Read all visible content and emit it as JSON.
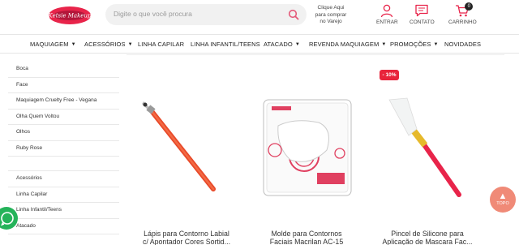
{
  "header": {
    "logo_text": "Ketsie Makeup",
    "search_placeholder": "Digite o que você procura",
    "varejo_line1": "Clique Aqui",
    "varejo_line2": "para comprar",
    "varejo_line3": "no Varejo",
    "entrar_label": "ENTRAR",
    "contato_label": "CONTATO",
    "carrinho_label": "CARRINHO",
    "cart_count": "0"
  },
  "nav": [
    {
      "label": "MAQUIAGEM",
      "chevron": true
    },
    {
      "label": "ACESSÓRIOS",
      "chevron": true
    },
    {
      "label": "LINHA CAPILAR",
      "chevron": false
    },
    {
      "label": "LINHA INFANTIL/TEENS",
      "chevron": false
    },
    {
      "label": "ATACADO",
      "chevron": true
    },
    {
      "label": "REVENDA MAQUIAGEM",
      "chevron": true
    },
    {
      "label": "PROMOÇÕES",
      "chevron": true
    },
    {
      "label": "NOVIDADES",
      "chevron": false
    }
  ],
  "sidebar": {
    "group1": [
      "Boca",
      "Face",
      "Maquiagem Cruelty Free - Vegana",
      "Olha Quem Voltou",
      "Olhos",
      "Ruby Rose"
    ],
    "group2": [
      "Acessórios",
      "Linha Capilar",
      "Linha Infantil/Teens",
      "Atacado"
    ]
  },
  "products": [
    {
      "line1": "Lápis para Contorno Labial",
      "line2": "c/ Apontador Cores Sortid..."
    },
    {
      "line1": "Molde para Contornos",
      "line2": "Faciais Macrilan AC-15"
    },
    {
      "line1": "Pincel de Silicone para",
      "line2": "Aplicação de Mascara Fac..."
    }
  ],
  "discount_badge": "- 10%",
  "topo_label": "TOPO",
  "colors": {
    "accent": "#e8243b",
    "search_bg": "#f1f1f1",
    "topo": "#f08a77",
    "whatsapp": "#25b35a"
  }
}
